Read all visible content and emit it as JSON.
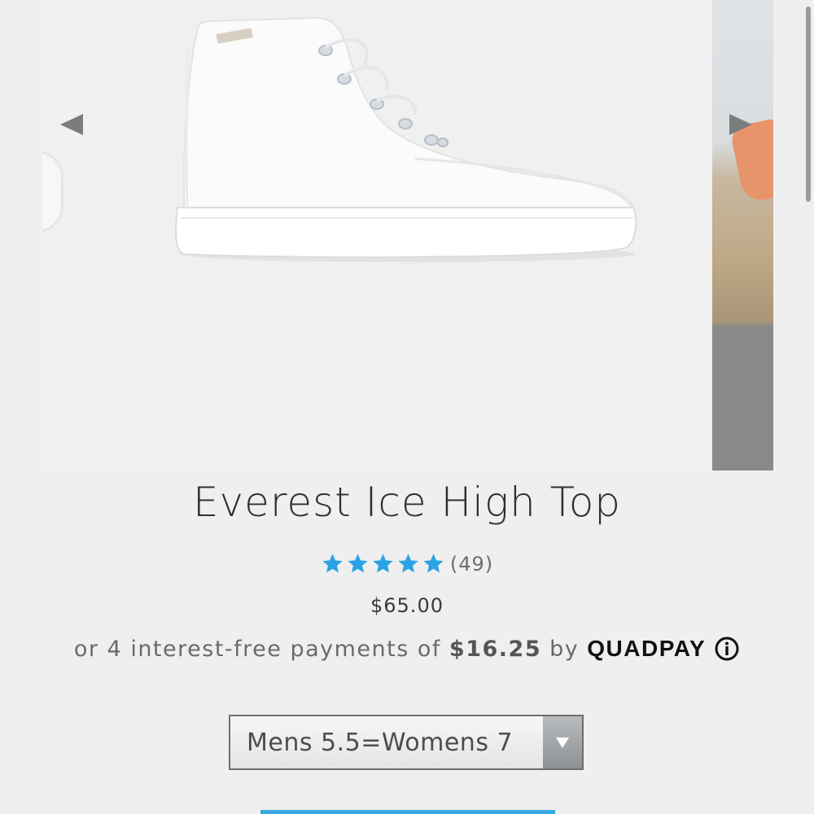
{
  "product": {
    "title": "Everest Ice High Top",
    "rating_count": "(49)",
    "rating_stars": 5,
    "price": "$65.00"
  },
  "installments": {
    "prefix": "or 4 interest-free payments of",
    "amount": "$16.25",
    "by": "by",
    "provider": "QUADPAY"
  },
  "size_selector": {
    "selected": "Mens 5.5=Womens 7"
  },
  "colors": {
    "star": "#2aa3e4",
    "accent_button": "#39a9e0"
  },
  "icons": {
    "prev": "triangle-left",
    "next": "triangle-right",
    "info": "circled-i"
  }
}
